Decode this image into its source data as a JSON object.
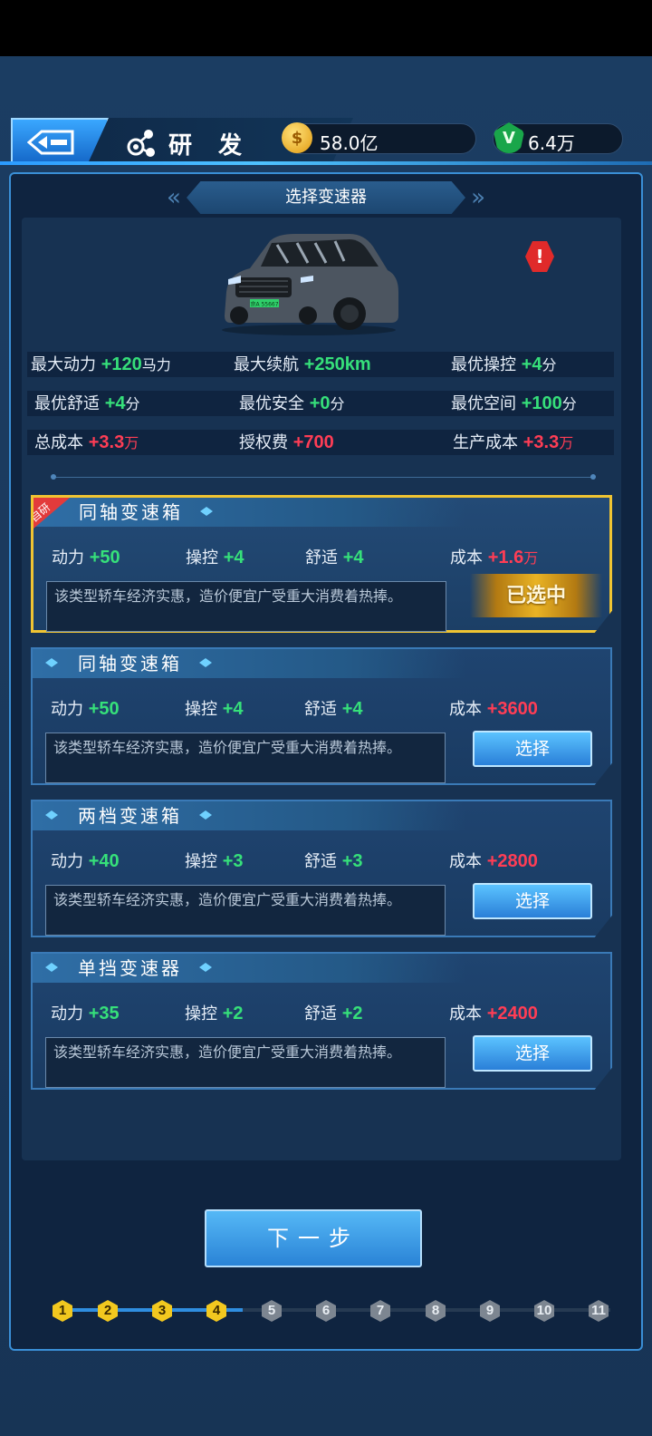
{
  "header": {
    "title": "研 发",
    "gold": "58.0亿",
    "gems": "6.4万"
  },
  "subtitle": "选择变速器",
  "stats": {
    "row1": [
      {
        "label": "最大动力",
        "value": "+120",
        "unit": "马力",
        "color": "green"
      },
      {
        "label": "最大续航",
        "value": "+250km",
        "unit": "",
        "color": "green"
      },
      {
        "label": "最优操控",
        "value": "+4",
        "unit": "分",
        "color": "green"
      }
    ],
    "row2": [
      {
        "label": "最优舒适",
        "value": "+4",
        "unit": "分",
        "color": "green"
      },
      {
        "label": "最优安全",
        "value": "+0",
        "unit": "分",
        "color": "green"
      },
      {
        "label": "最优空间",
        "value": "+100",
        "unit": "分",
        "color": "green"
      }
    ],
    "row3": [
      {
        "label": "总成本",
        "value": "+3.3",
        "unit": "万",
        "color": "red"
      },
      {
        "label": "授权费",
        "value": "+700",
        "unit": "",
        "color": "red"
      },
      {
        "label": "生产成本",
        "value": "+3.3",
        "unit": "万",
        "color": "red"
      }
    ]
  },
  "options": [
    {
      "name": "同轴变速箱",
      "badge": "自研",
      "power_label": "动力",
      "power": "+50",
      "control_label": "操控",
      "control": "+4",
      "comfort_label": "舒适",
      "comfort": "+4",
      "cost_label": "成本",
      "cost": "+1.6",
      "cost_unit": "万",
      "desc": "该类型轿车经济实惠，造价便宜广受重大消费着热捧。",
      "button": "已选中",
      "selected": true
    },
    {
      "name": "同轴变速箱",
      "power_label": "动力",
      "power": "+50",
      "control_label": "操控",
      "control": "+4",
      "comfort_label": "舒适",
      "comfort": "+4",
      "cost_label": "成本",
      "cost": "+3600",
      "cost_unit": "",
      "desc": "该类型轿车经济实惠，造价便宜广受重大消费着热捧。",
      "button": "选择",
      "selected": false
    },
    {
      "name": "两档变速箱",
      "power_label": "动力",
      "power": "+40",
      "control_label": "操控",
      "control": "+3",
      "comfort_label": "舒适",
      "comfort": "+3",
      "cost_label": "成本",
      "cost": "+2800",
      "cost_unit": "",
      "desc": "该类型轿车经济实惠，造价便宜广受重大消费着热捧。",
      "button": "选择",
      "selected": false
    },
    {
      "name": "单挡变速器",
      "power_label": "动力",
      "power": "+35",
      "control_label": "操控",
      "control": "+2",
      "comfort_label": "舒适",
      "comfort": "+2",
      "cost_label": "成本",
      "cost": "+2400",
      "cost_unit": "",
      "desc": "该类型轿车经济实惠，造价便宜广受重大消费着热捧。",
      "button": "选择",
      "selected": false
    }
  ],
  "next_button": "下一步",
  "car_plate": "京A 55667",
  "steps": [
    "1",
    "2",
    "3",
    "4",
    "5",
    "6",
    "7",
    "8",
    "9",
    "10",
    "11"
  ],
  "current_step": 4,
  "colors": {
    "gain": "#36e07a",
    "cost": "#ff3d55",
    "selected_border": "#f0c432",
    "accent": "#3a8fd6"
  }
}
